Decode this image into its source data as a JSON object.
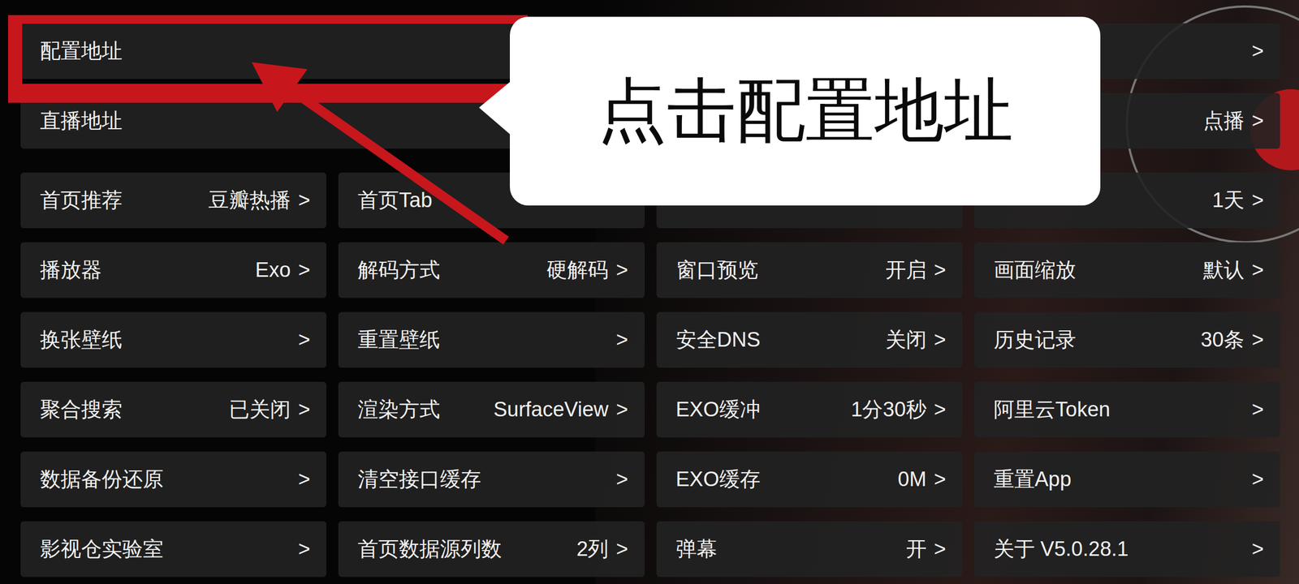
{
  "primary": [
    {
      "label": "配置地址",
      "value": "",
      "arrow": ">"
    },
    {
      "label": "直播地址",
      "value": "点播",
      "arrow": ">"
    }
  ],
  "grid": [
    [
      {
        "label": "首页推荐",
        "value": "豆瓣热播",
        "arrow": ">"
      },
      {
        "label": "首页Tab",
        "value": "",
        "arrow": ""
      },
      {
        "label": "",
        "value": "",
        "arrow": ""
      },
      {
        "label": "",
        "value": "1天",
        "arrow": ">"
      }
    ],
    [
      {
        "label": "播放器",
        "value": "Exo",
        "arrow": ">"
      },
      {
        "label": "解码方式",
        "value": "硬解码",
        "arrow": ">"
      },
      {
        "label": "窗口预览",
        "value": "开启",
        "arrow": ">"
      },
      {
        "label": "画面缩放",
        "value": "默认",
        "arrow": ">"
      }
    ],
    [
      {
        "label": "换张壁纸",
        "value": "",
        "arrow": ">"
      },
      {
        "label": "重置壁纸",
        "value": "",
        "arrow": ">"
      },
      {
        "label": "安全DNS",
        "value": "关闭",
        "arrow": ">"
      },
      {
        "label": "历史记录",
        "value": "30条",
        "arrow": ">"
      }
    ],
    [
      {
        "label": "聚合搜索",
        "value": "已关闭",
        "arrow": ">"
      },
      {
        "label": "渲染方式",
        "value": "SurfaceView",
        "arrow": ">"
      },
      {
        "label": "EXO缓冲",
        "value": "1分30秒",
        "arrow": ">"
      },
      {
        "label": "阿里云Token",
        "value": "",
        "arrow": ">"
      }
    ],
    [
      {
        "label": "数据备份还原",
        "value": "",
        "arrow": ">"
      },
      {
        "label": "清空接口缓存",
        "value": "",
        "arrow": ">"
      },
      {
        "label": "EXO缓存",
        "value": "0M",
        "arrow": ">"
      },
      {
        "label": "重置App",
        "value": "",
        "arrow": ">"
      }
    ],
    [
      {
        "label": "影视仓实验室",
        "value": "",
        "arrow": ">"
      },
      {
        "label": "首页数据源列数",
        "value": "2列",
        "arrow": ">"
      },
      {
        "label": "弹幕",
        "value": "开",
        "arrow": ">"
      },
      {
        "label": "关于  V5.0.28.1",
        "value": "",
        "arrow": ">"
      }
    ]
  ],
  "overlay": {
    "callout": "点击配置地址"
  }
}
